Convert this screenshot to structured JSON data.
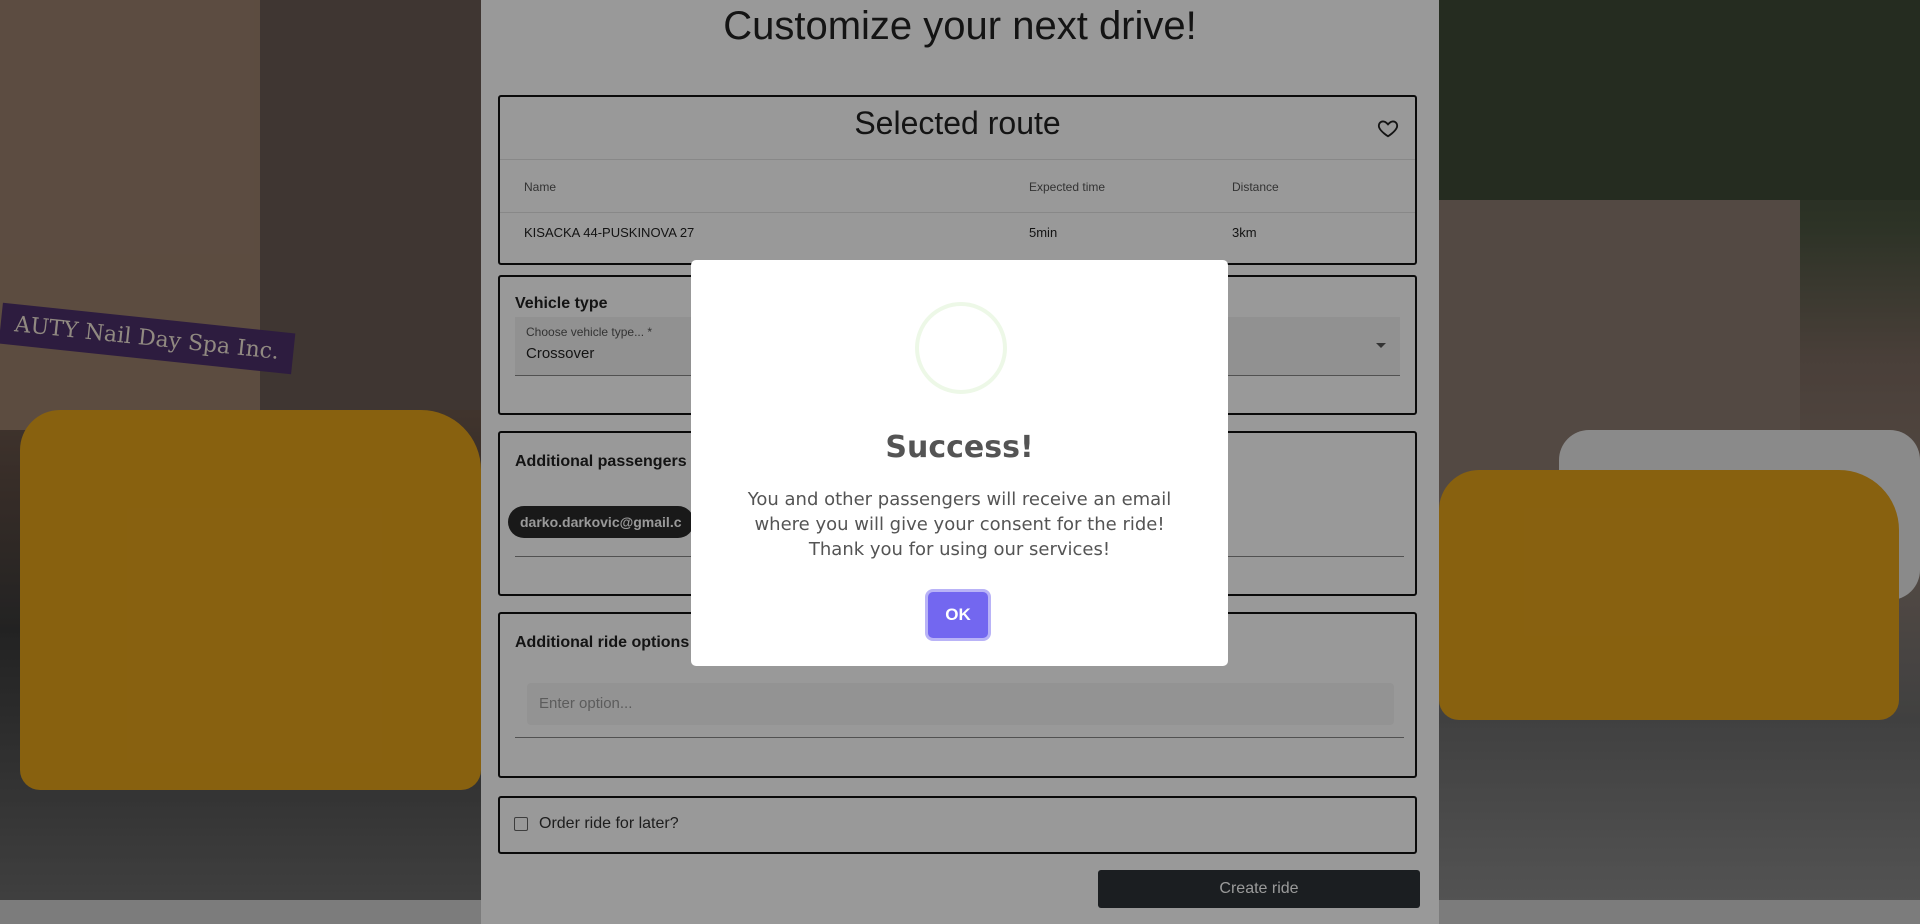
{
  "page": {
    "title": "Customize your next drive!"
  },
  "background": {
    "sign_text": "AUTY Nail Day Spa Inc."
  },
  "route_card": {
    "title": "Selected route",
    "favorite_icon": "heart-icon",
    "columns": [
      "Name",
      "Expected time",
      "Distance"
    ],
    "rows": [
      {
        "name": "KISACKA 44-PUSKINOVA 27",
        "expected_time": "5min",
        "distance": "3km"
      }
    ]
  },
  "vehicle": {
    "section_label": "Vehicle type",
    "field_label": "Choose vehicle type... *",
    "value": "Crossover"
  },
  "passengers": {
    "section_label": "Additional passengers",
    "chip": "darko.darkovic@gmail.c"
  },
  "ride_options": {
    "section_label": "Additional ride options",
    "placeholder": "Enter option..."
  },
  "order_later": {
    "label": "Order ride for later?"
  },
  "create_button": "Create ride",
  "modal": {
    "title": "Success!",
    "message": "You and other passengers will receive an email where you will give your consent for the ride! Thank you for using our services!",
    "ok_label": "OK",
    "accent_color": "#7367f0"
  }
}
